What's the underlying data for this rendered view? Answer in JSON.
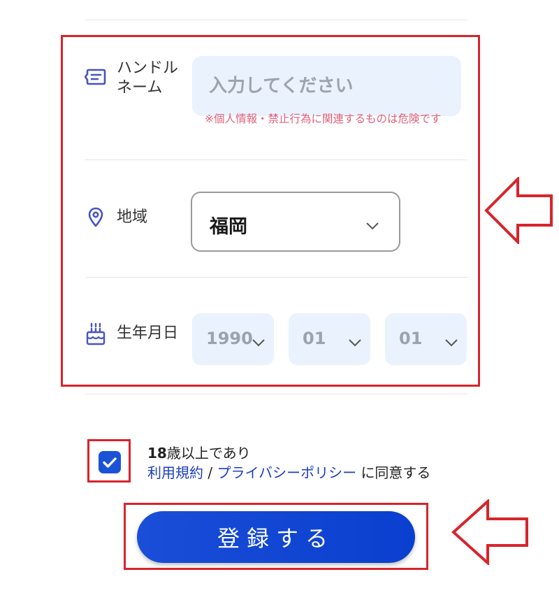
{
  "handle_name": {
    "label_line1": "ハンドル",
    "label_line2": "ネーム",
    "icon": "message-icon",
    "placeholder": "入力してください",
    "value": "",
    "warning": "※個人情報・禁止行為に関連するものは危険です"
  },
  "region": {
    "label": "地域",
    "icon": "location-pin-icon",
    "value": "福岡"
  },
  "birthdate": {
    "label": "生年月日",
    "icon": "cake-icon",
    "year": "1990",
    "month": "01",
    "day": "01"
  },
  "agreement": {
    "checked": true,
    "age_number": "18",
    "age_text": "歳以上であり",
    "terms_link": "利用規約",
    "separator": "/",
    "privacy_link": "プライバシーポリシー",
    "agree_suffix": "に同意する"
  },
  "submit": {
    "label": "登録する"
  },
  "colors": {
    "accent": "#1a53d6",
    "input_bg": "#eaf2fe",
    "warning": "#e0607a",
    "highlight": "#d8242c",
    "link": "#1c3ec4"
  }
}
